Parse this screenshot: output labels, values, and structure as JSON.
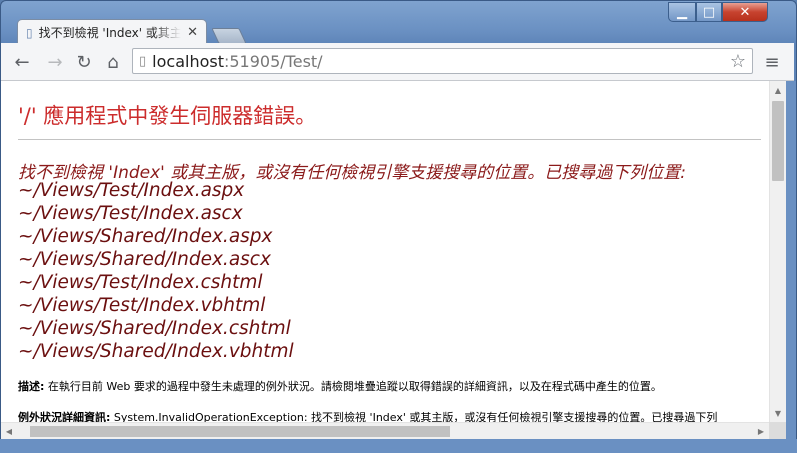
{
  "tab": {
    "title": "找不到檢視 'Index' 或其主版"
  },
  "address": {
    "host": "localhost",
    "rest": ":51905/Test/"
  },
  "page": {
    "heading": "'/' 應用程式中發生伺服器錯誤。",
    "error_title": "找不到檢視 'Index' 或其主版，或沒有任何檢視引擎支援搜尋的位置。已搜尋過下列位置:",
    "paths": [
      "~/Views/Test/Index.aspx",
      "~/Views/Test/Index.ascx",
      "~/Views/Shared/Index.aspx",
      "~/Views/Shared/Index.ascx",
      "~/Views/Test/Index.cshtml",
      "~/Views/Test/Index.vbhtml",
      "~/Views/Shared/Index.cshtml",
      "~/Views/Shared/Index.vbhtml"
    ],
    "description_label": "描述:",
    "description_text": " 在執行目前 Web 要求的過程中發生未處理的例外狀況。請檢閱堆疊追蹤以取得錯誤的詳細資訊，以及在程式碼中產生的位置。",
    "exception_label": "例外狀況詳細資訊:",
    "exception_text": " System.InvalidOperationException: 找不到檢視 'Index' 或其主版，或沒有任何檢視引擎支援搜尋的位置。已搜尋過下列"
  }
}
